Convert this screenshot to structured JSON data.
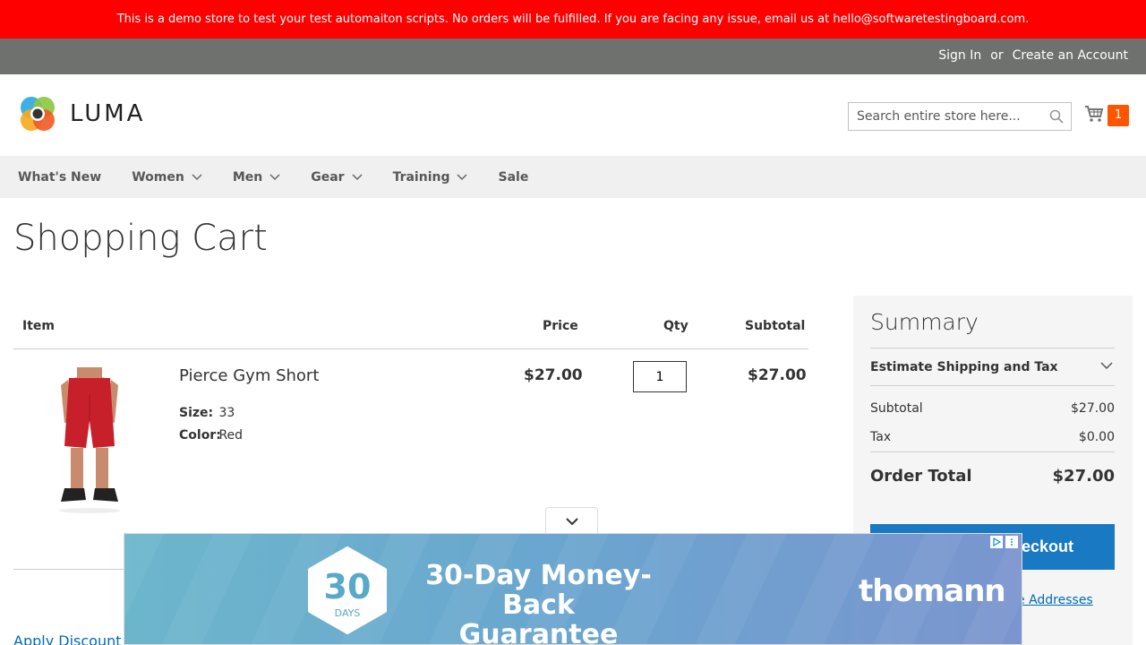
{
  "demo_notice": "This is a demo store to test your test automaiton scripts. No orders will be fulfilled. If you are facing any issue, email us at hello@softwaretestingboard.com.",
  "auth": {
    "sign_in": "Sign In",
    "or": "or",
    "create_account": "Create an Account"
  },
  "header": {
    "logo_text": "LUMA",
    "search_placeholder": "Search entire store here...",
    "cart_count": "1"
  },
  "nav": {
    "items": [
      {
        "label": "What's New",
        "has_dropdown": false
      },
      {
        "label": "Women",
        "has_dropdown": true
      },
      {
        "label": "Men",
        "has_dropdown": true
      },
      {
        "label": "Gear",
        "has_dropdown": true
      },
      {
        "label": "Training",
        "has_dropdown": true
      },
      {
        "label": "Sale",
        "has_dropdown": false
      }
    ]
  },
  "page_title": "Shopping Cart",
  "cart": {
    "headers": {
      "item": "Item",
      "price": "Price",
      "qty": "Qty",
      "subtotal": "Subtotal"
    },
    "items": [
      {
        "name": "Pierce Gym Short",
        "options": [
          {
            "label": "Size:",
            "value": "33"
          },
          {
            "label": "Color:",
            "value": "Red"
          }
        ],
        "price": "$27.00",
        "qty": "1",
        "subtotal": "$27.00"
      }
    ],
    "discount_link": "Apply Discount C"
  },
  "summary": {
    "title": "Summary",
    "estimate": "Estimate Shipping and Tax",
    "subtotal_label": "Subtotal",
    "subtotal_value": "$27.00",
    "tax_label": "Tax",
    "tax_value": "$0.00",
    "order_total_label": "Order Total",
    "order_total_value": "$27.00",
    "checkout_label": "eckout",
    "multi_address_link": "e Addresses"
  },
  "ad": {
    "hex_number": "30",
    "hex_days": "DAYS",
    "headline_line1": "30-Day Money-Back",
    "headline_line2": "Guarantee",
    "brand": "thomann"
  },
  "colors": {
    "demo_bar": "#ff0000",
    "auth_bar": "#6e716e",
    "cart_badge": "#ff5501",
    "checkout_button": "#1979c3",
    "link": "#006bb4"
  }
}
